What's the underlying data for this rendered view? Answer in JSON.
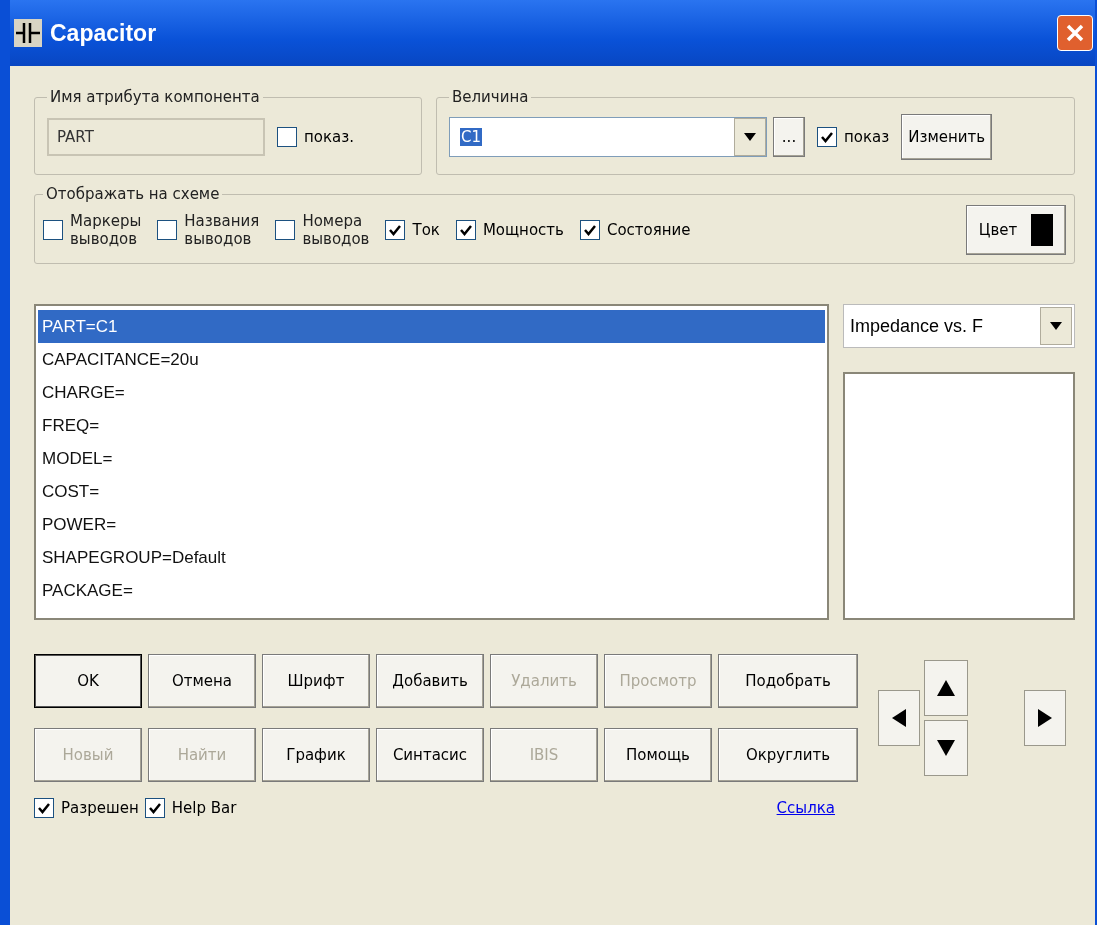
{
  "window": {
    "title": "Capacitor"
  },
  "attribute_name": {
    "legend": "Имя атрибута компонента",
    "value": "PART",
    "show": {
      "label": "показ.",
      "checked": false
    }
  },
  "value_group": {
    "legend": "Величина",
    "value": "C1",
    "browse_button": "...",
    "show": {
      "label": "показ",
      "checked": true
    },
    "change_button": "Изменить"
  },
  "display_group": {
    "legend": "Отображать на схеме",
    "options": [
      {
        "label": "Маркеры выводов",
        "checked": false
      },
      {
        "label": "Названия выводов",
        "checked": false
      },
      {
        "label": "Номера выводов",
        "checked": false
      },
      {
        "label": "Ток",
        "checked": true
      },
      {
        "label": "Мощность",
        "checked": true
      },
      {
        "label": "Состояние",
        "checked": true
      }
    ],
    "color_button": "Цвет",
    "color": "#000000"
  },
  "attributes": [
    {
      "text": "PART=C1",
      "selected": true
    },
    {
      "text": "CAPACITANCE=20u",
      "selected": false
    },
    {
      "text": "CHARGE=",
      "selected": false
    },
    {
      "text": "FREQ=",
      "selected": false
    },
    {
      "text": "MODEL=",
      "selected": false
    },
    {
      "text": "COST=",
      "selected": false
    },
    {
      "text": "POWER=",
      "selected": false
    },
    {
      "text": "SHAPEGROUP=Default",
      "selected": false
    },
    {
      "text": "PACKAGE=",
      "selected": false
    }
  ],
  "plot_select": {
    "value": "Impedance vs. F"
  },
  "button_rows": [
    [
      {
        "label": "OK",
        "disabled": false,
        "default": true
      },
      {
        "label": "Отмена",
        "disabled": false,
        "default": false
      },
      {
        "label": "Шрифт",
        "disabled": false,
        "default": false
      },
      {
        "label": "Добавить",
        "disabled": false,
        "default": false
      },
      {
        "label": "Удалить",
        "disabled": true,
        "default": false
      },
      {
        "label": "Просмотр",
        "disabled": true,
        "default": false
      },
      {
        "label": "Подобрать",
        "disabled": false,
        "default": false
      }
    ],
    [
      {
        "label": "Новый",
        "disabled": true,
        "default": false
      },
      {
        "label": "Найти",
        "disabled": true,
        "default": false
      },
      {
        "label": "График",
        "disabled": false,
        "default": false
      },
      {
        "label": "Синтасис",
        "disabled": false,
        "default": false
      },
      {
        "label": "IBIS",
        "disabled": true,
        "default": false
      },
      {
        "label": "Помощь",
        "disabled": false,
        "default": false
      },
      {
        "label": "Округлить",
        "disabled": false,
        "default": false
      }
    ]
  ],
  "footer": {
    "options": [
      {
        "label": "Разрешен",
        "checked": true
      },
      {
        "label": "Help Bar",
        "checked": true
      }
    ],
    "link": "Ссылка"
  }
}
